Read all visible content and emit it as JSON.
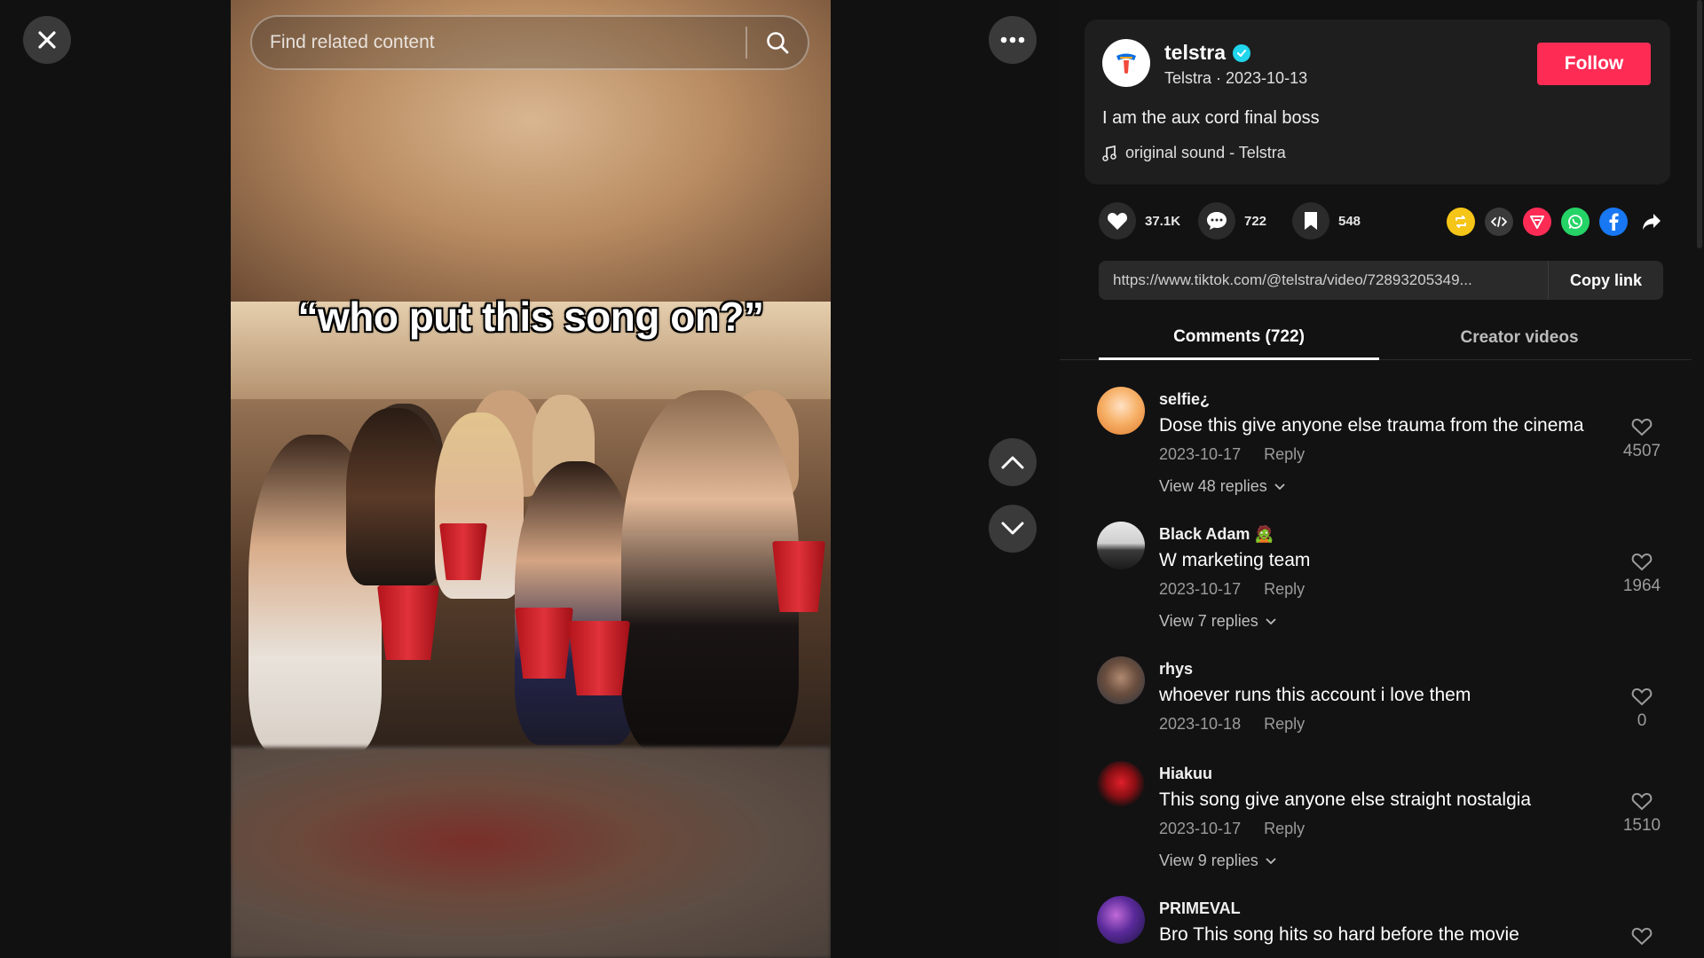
{
  "search": {
    "placeholder": "Find related content"
  },
  "video": {
    "caption": "“who put this song on?”"
  },
  "author": {
    "username": "telstra",
    "subtitle": "Telstra · 2023-10-13",
    "follow_label": "Follow",
    "description": "I am the aux cord final boss",
    "music": "original sound - Telstra"
  },
  "actions": {
    "likes": "37.1K",
    "comments": "722",
    "saves": "548"
  },
  "share_icons": [
    "repost-icon",
    "embed-icon",
    "send-to-friend-icon",
    "whatsapp-icon",
    "facebook-icon",
    "share-arrow-icon"
  ],
  "link": {
    "url": "https://www.tiktok.com/@telstra/video/72893205349...",
    "copy_label": "Copy link"
  },
  "tabs": [
    {
      "label": "Comments (722)"
    },
    {
      "label": "Creator videos"
    }
  ],
  "comments": [
    {
      "user": "selfie¿",
      "text": "Dose this give anyone else trauma from the cinema",
      "date": "2023-10-17",
      "reply": "Reply",
      "likes": "4507",
      "replies": "View 48 replies"
    },
    {
      "user": "Black Adam 🧟",
      "text": "W marketing team",
      "date": "2023-10-17",
      "reply": "Reply",
      "likes": "1964",
      "replies": "View 7 replies"
    },
    {
      "user": "rhys",
      "text": "whoever runs this account i love them",
      "date": "2023-10-18",
      "reply": "Reply",
      "likes": "0",
      "replies": ""
    },
    {
      "user": "Hiakuu",
      "text": "This song give anyone else straight nostalgia",
      "date": "2023-10-17",
      "reply": "Reply",
      "likes": "1510",
      "replies": "View 9 replies"
    },
    {
      "user": "PRIMEVAL",
      "text": "Bro This song hits so hard before the movie",
      "date": "",
      "reply": "",
      "likes": "",
      "replies": ""
    }
  ],
  "colors": {
    "follow": "#fe2c55",
    "verified": "#20d5ec",
    "background": "#121212"
  }
}
